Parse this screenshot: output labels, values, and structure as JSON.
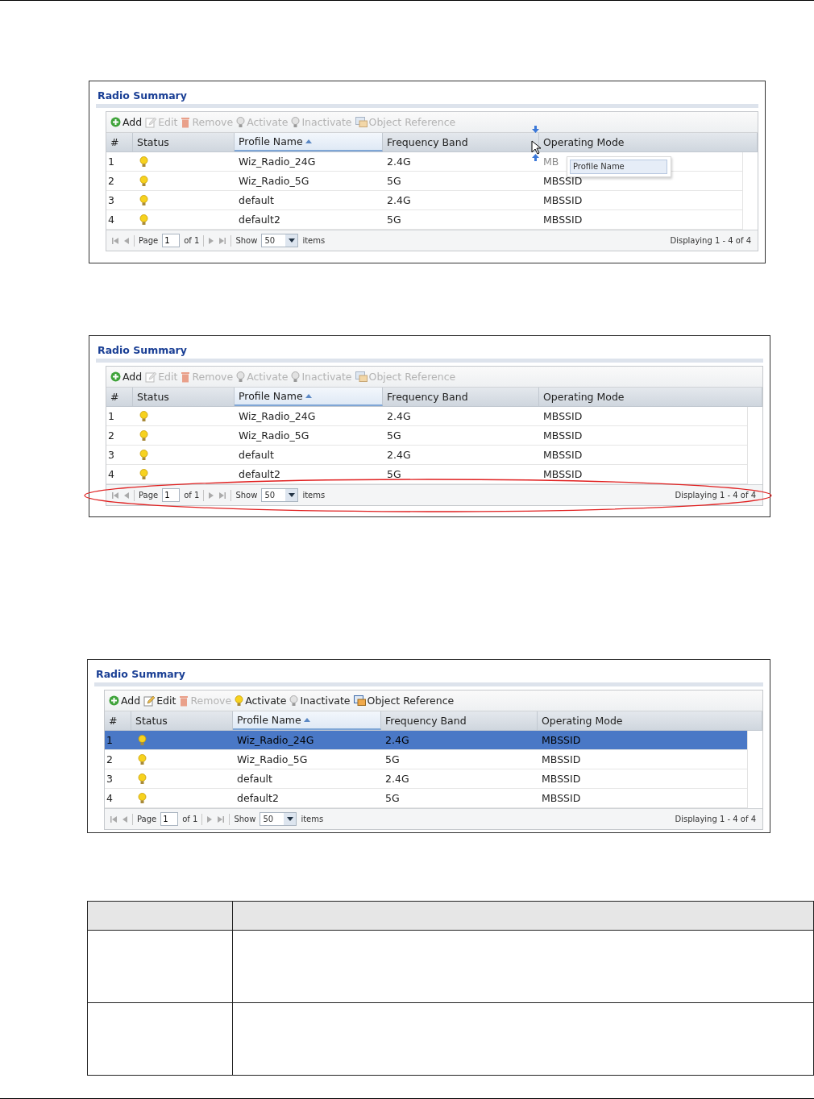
{
  "panels": [
    {
      "title": "Radio Summary",
      "overlay": {
        "kind": "column_drag",
        "tooltip": "Profile Name"
      },
      "toolbar": [
        {
          "label": "Add",
          "kind": "add",
          "disabled": false
        },
        {
          "label": "Edit",
          "kind": "edit",
          "disabled": true
        },
        {
          "label": "Remove",
          "kind": "remove",
          "disabled": true
        },
        {
          "label": "Activate",
          "kind": "activate",
          "disabled": true
        },
        {
          "label": "Inactivate",
          "kind": "inactivate",
          "disabled": true
        },
        {
          "label": "Object Reference",
          "kind": "reference",
          "disabled": true
        }
      ],
      "columns": [
        {
          "label": "#",
          "sorted": false
        },
        {
          "label": "Status",
          "sorted": false
        },
        {
          "label": "Profile Name",
          "sorted": true
        },
        {
          "label": "Frequency Band",
          "sorted": false
        },
        {
          "label": "Operating Mode",
          "sorted": false
        }
      ],
      "rows": [
        {
          "num": "1",
          "on": true,
          "profile": "Wiz_Radio_24G",
          "band": "2.4G",
          "mode": "MB",
          "selected": false
        },
        {
          "num": "2",
          "on": true,
          "profile": "Wiz_Radio_5G",
          "band": "5G",
          "mode": "MBSSID",
          "selected": false
        },
        {
          "num": "3",
          "on": true,
          "profile": "default",
          "band": "2.4G",
          "mode": "MBSSID",
          "selected": false
        },
        {
          "num": "4",
          "on": true,
          "profile": "default2",
          "band": "5G",
          "mode": "MBSSID",
          "selected": false
        }
      ],
      "pager": {
        "page_label": "Page",
        "page": "1",
        "of": "of 1",
        "show_label": "Show",
        "show": "50",
        "items": "items",
        "displaying": "Displaying 1 - 4 of 4"
      }
    },
    {
      "title": "Radio Summary",
      "overlay": {
        "kind": "highlight_ellipse"
      },
      "toolbar": [
        {
          "label": "Add",
          "kind": "add",
          "disabled": false
        },
        {
          "label": "Edit",
          "kind": "edit",
          "disabled": true
        },
        {
          "label": "Remove",
          "kind": "remove",
          "disabled": true
        },
        {
          "label": "Activate",
          "kind": "activate",
          "disabled": true
        },
        {
          "label": "Inactivate",
          "kind": "inactivate",
          "disabled": true
        },
        {
          "label": "Object Reference",
          "kind": "reference",
          "disabled": true
        }
      ],
      "columns": [
        {
          "label": "#",
          "sorted": false
        },
        {
          "label": "Status",
          "sorted": false
        },
        {
          "label": "Profile Name",
          "sorted": true
        },
        {
          "label": "Frequency Band",
          "sorted": false
        },
        {
          "label": "Operating Mode",
          "sorted": false
        }
      ],
      "rows": [
        {
          "num": "1",
          "on": true,
          "profile": "Wiz_Radio_24G",
          "band": "2.4G",
          "mode": "MBSSID",
          "selected": false
        },
        {
          "num": "2",
          "on": true,
          "profile": "Wiz_Radio_5G",
          "band": "5G",
          "mode": "MBSSID",
          "selected": false
        },
        {
          "num": "3",
          "on": true,
          "profile": "default",
          "band": "2.4G",
          "mode": "MBSSID",
          "selected": false
        },
        {
          "num": "4",
          "on": true,
          "profile": "default2",
          "band": "5G",
          "mode": "MBSSID",
          "selected": false
        }
      ],
      "pager": {
        "page_label": "Page",
        "page": "1",
        "of": "of 1",
        "show_label": "Show",
        "show": "50",
        "items": "items",
        "displaying": "Displaying 1 - 4 of 4"
      }
    },
    {
      "title": "Radio Summary",
      "toolbar": [
        {
          "label": "Add",
          "kind": "add",
          "disabled": false
        },
        {
          "label": "Edit",
          "kind": "edit",
          "disabled": false
        },
        {
          "label": "Remove",
          "kind": "remove",
          "disabled": true
        },
        {
          "label": "Activate",
          "kind": "activate",
          "disabled": false
        },
        {
          "label": "Inactivate",
          "kind": "inactivate",
          "disabled": false
        },
        {
          "label": "Object Reference",
          "kind": "reference",
          "disabled": false
        }
      ],
      "columns": [
        {
          "label": "#",
          "sorted": false
        },
        {
          "label": "Status",
          "sorted": false
        },
        {
          "label": "Profile Name",
          "sorted": true
        },
        {
          "label": "Frequency Band",
          "sorted": false
        },
        {
          "label": "Operating Mode",
          "sorted": false
        }
      ],
      "rows": [
        {
          "num": "1",
          "on": true,
          "profile": "Wiz_Radio_24G",
          "band": "2.4G",
          "mode": "MBSSID",
          "selected": true
        },
        {
          "num": "2",
          "on": true,
          "profile": "Wiz_Radio_5G",
          "band": "5G",
          "mode": "MBSSID",
          "selected": false
        },
        {
          "num": "3",
          "on": true,
          "profile": "default",
          "band": "2.4G",
          "mode": "MBSSID",
          "selected": false
        },
        {
          "num": "4",
          "on": true,
          "profile": "default2",
          "band": "5G",
          "mode": "MBSSID",
          "selected": false
        }
      ],
      "pager": {
        "page_label": "Page",
        "page": "1",
        "of": "of 1",
        "show_label": "Show",
        "show": "50",
        "items": "items",
        "displaying": "Displaying 1 - 4 of 4"
      }
    }
  ]
}
